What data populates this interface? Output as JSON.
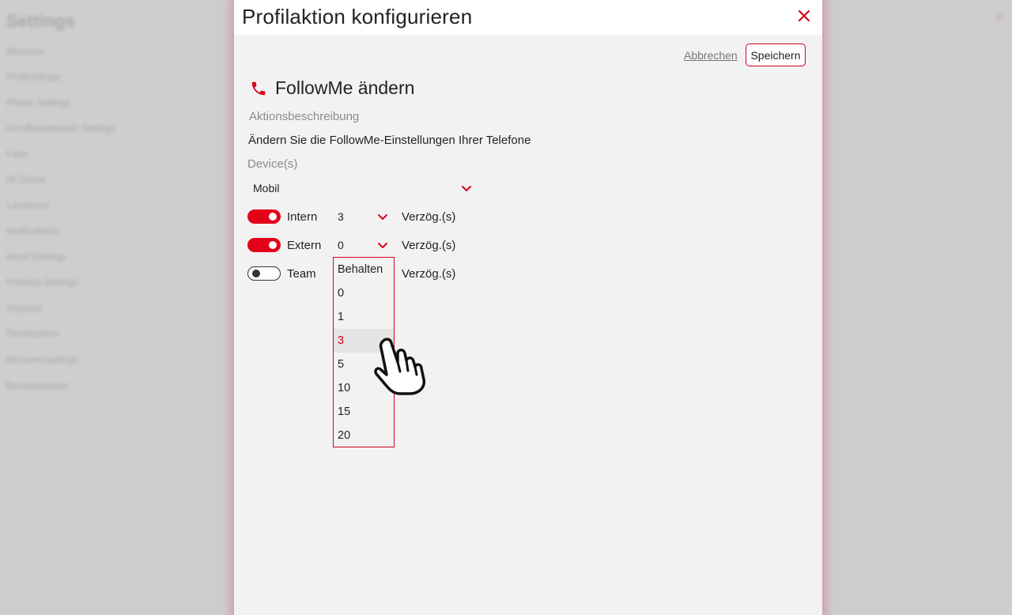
{
  "background": {
    "title": "Settings",
    "items": [
      "Benutzer",
      "Profilsettings",
      "Phone Settings",
      "Anrufbeantworter Settings",
      "Faxe",
      "Nr.Dienst",
      "Landesruf",
      "Notifications",
      "Anruf.Settings",
      "Presenz-Settings",
      "Abweise",
      "Dienstzeiten",
      "Netzwerksettings",
      "Benutzerdaten"
    ]
  },
  "dialog": {
    "title": "Profilaktion konfigurieren",
    "cancel_label": "Abbrechen",
    "save_label": "Speichern",
    "section_title": "FollowMe ändern",
    "description_label": "Aktionsbeschreibung",
    "description": "Ändern Sie die FollowMe-Einstellungen Ihrer Telefone",
    "devices_label": "Device(s)",
    "device_value": "Mobil",
    "rows": [
      {
        "label": "Intern",
        "enabled": true,
        "delay": "3",
        "unit": "Verzög.(s)"
      },
      {
        "label": "Extern",
        "enabled": true,
        "delay": "0",
        "unit": "Verzög.(s)"
      },
      {
        "label": "Team",
        "enabled": false,
        "delay": "",
        "unit": "Verzög.(s)"
      }
    ],
    "dropdown_options": [
      "Behalten",
      "0",
      "1",
      "3",
      "5",
      "10",
      "15",
      "20"
    ],
    "dropdown_highlighted": "3"
  },
  "colors": {
    "accent": "#d9001b",
    "toggle_on": "#e3001b",
    "dialog_bg": "#f2f2f2"
  },
  "icons": {
    "close": "close-icon",
    "phone": "phone-icon",
    "chevron": "chevron-down-icon",
    "cursor": "hand-pointer-cursor"
  }
}
